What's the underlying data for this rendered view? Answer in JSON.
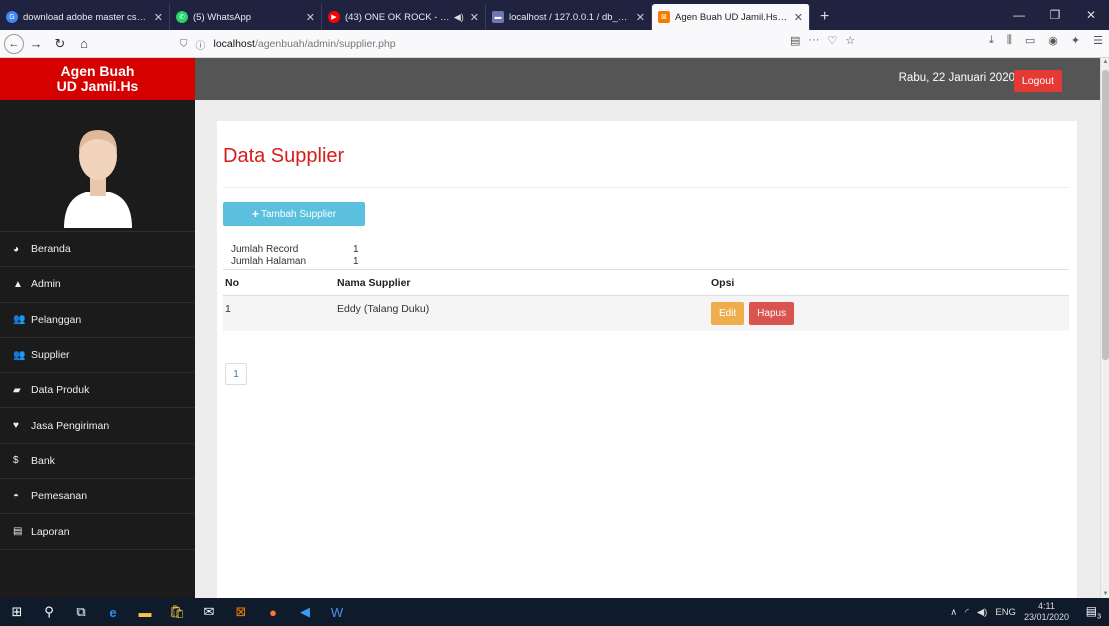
{
  "browser": {
    "tabs": [
      {
        "title": "download adobe master cs 3 t",
        "favicon_color": "#4285f4",
        "favicon_icon": "google-icon",
        "active": false
      },
      {
        "title": "(5) WhatsApp",
        "favicon_color": "#25d366",
        "favicon_icon": "whatsapp-icon",
        "active": false
      },
      {
        "title": "(43) ONE OK ROCK - Where",
        "favicon_color": "#ff0000",
        "favicon_icon": "youtube-icon",
        "active": false
      },
      {
        "title": "localhost / 127.0.0.1 / db_agen",
        "favicon_color": "#6c78af",
        "favicon_icon": "phpmyadmin-icon",
        "active": false
      },
      {
        "title": "Agen Buah UD Jamil.Hs - Adm",
        "favicon_color": "#f57c00",
        "favicon_icon": "xampp-icon",
        "active": true
      }
    ],
    "url_host": "localhost",
    "url_path": "/agenbuah/admin/supplier.php"
  },
  "app": {
    "brand_line1": "Agen Buah",
    "brand_line2": "UD Jamil.Hs",
    "date": "Rabu, 22 Januari 2020",
    "logout_label": "Logout",
    "accent_color": "#d50000",
    "menu": [
      {
        "label": "Beranda",
        "icon": "dashboard-icon"
      },
      {
        "label": "Admin",
        "icon": "user-icon"
      },
      {
        "label": "Pelanggan",
        "icon": "users-icon"
      },
      {
        "label": "Supplier",
        "icon": "users-icon"
      },
      {
        "label": "Data Produk",
        "icon": "folder-icon"
      },
      {
        "label": "Jasa Pengiriman",
        "icon": "map-marker-icon"
      },
      {
        "label": "Bank",
        "icon": "dollar-icon"
      },
      {
        "label": "Pemesanan",
        "icon": "inbox-icon"
      },
      {
        "label": "Laporan",
        "icon": "list-icon"
      }
    ]
  },
  "content": {
    "title": "Data Supplier",
    "add_button": "Tambah Supplier",
    "jumlah_record_label": "Jumlah Record",
    "jumlah_record_value": "1",
    "jumlah_halaman_label": "Jumlah Halaman",
    "jumlah_halaman_value": "1",
    "columns": [
      "No",
      "Nama Supplier",
      "Opsi"
    ],
    "rows": [
      {
        "no": "1",
        "nama": "Eddy (Talang Duku)",
        "edit": "Edit",
        "hapus": "Hapus"
      }
    ],
    "pages": [
      "1"
    ]
  },
  "taskbar": {
    "language": "ENG",
    "time": "4:11",
    "date": "23/01/2020",
    "notification_count": "3"
  }
}
